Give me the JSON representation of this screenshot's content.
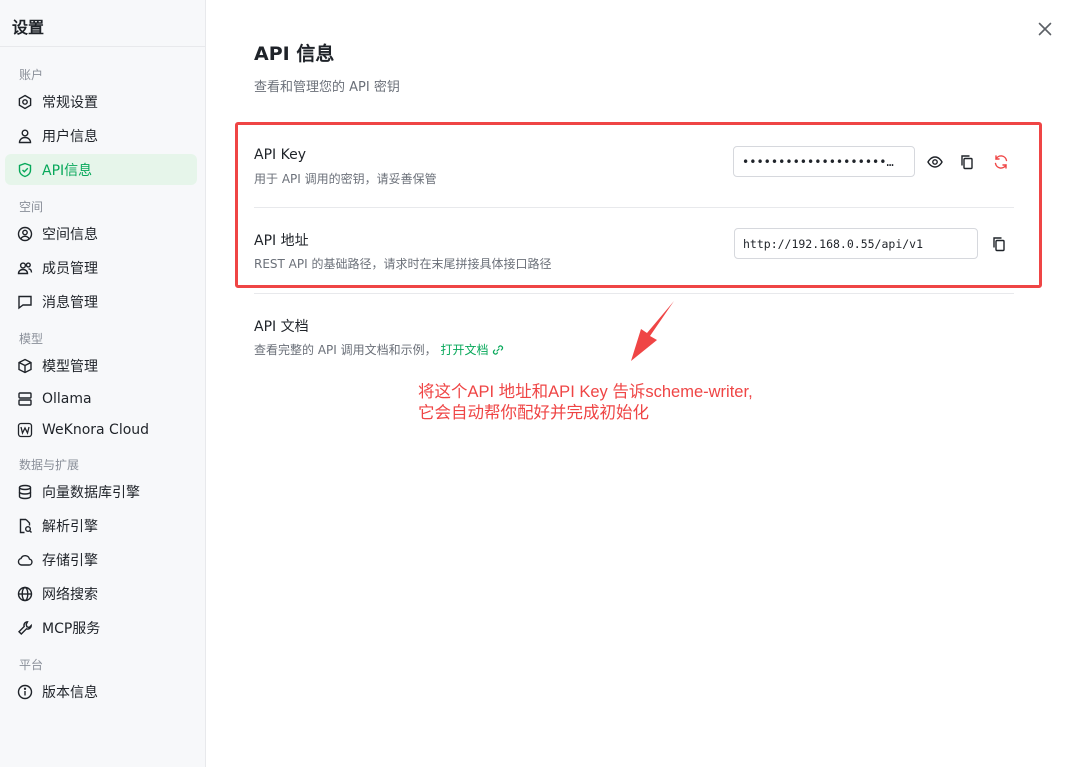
{
  "sidebar": {
    "title": "设置",
    "groups": [
      {
        "label": "账户",
        "items": [
          {
            "label": "常规设置",
            "icon": "settings-hexagon-icon"
          },
          {
            "label": "用户信息",
            "icon": "user-icon"
          },
          {
            "label": "API信息",
            "icon": "shield-check-icon",
            "active": true
          }
        ]
      },
      {
        "label": "空间",
        "items": [
          {
            "label": "空间信息",
            "icon": "user-circle-icon"
          },
          {
            "label": "成员管理",
            "icon": "users-icon"
          },
          {
            "label": "消息管理",
            "icon": "message-square-icon"
          }
        ]
      },
      {
        "label": "模型",
        "items": [
          {
            "label": "模型管理",
            "icon": "cube-icon"
          },
          {
            "label": "Ollama",
            "icon": "server-icon"
          },
          {
            "label": "WeKnora Cloud",
            "icon": "weknora-logo-icon"
          }
        ]
      },
      {
        "label": "数据与扩展",
        "items": [
          {
            "label": "向量数据库引擎",
            "icon": "database-icon"
          },
          {
            "label": "解析引擎",
            "icon": "file-search-icon"
          },
          {
            "label": "存储引擎",
            "icon": "cloud-icon"
          },
          {
            "label": "网络搜索",
            "icon": "globe-icon"
          },
          {
            "label": "MCP服务",
            "icon": "wrench-icon"
          }
        ]
      },
      {
        "label": "平台",
        "items": [
          {
            "label": "版本信息",
            "icon": "info-circle-icon"
          }
        ]
      }
    ]
  },
  "main": {
    "title": "API 信息",
    "subtitle": "查看和管理您的 API 密钥",
    "api_key": {
      "title": "API Key",
      "desc": "用于 API 调用的密钥，请妥善保管",
      "value": "••••••••••••••••••••…"
    },
    "api_url": {
      "title": "API 地址",
      "desc": "REST API 的基础路径，请求时在末尾拼接具体接口路径",
      "value": "http://192.168.0.55/api/v1"
    },
    "api_docs": {
      "title": "API 文档",
      "desc": "查看完整的 API 调用文档和示例，",
      "link_label": "打开文档"
    }
  },
  "annotation": {
    "line1": "将这个API 地址和API Key 告诉scheme-writer,",
    "line2": "它会自动帮你配好并完成初始化"
  },
  "colors": {
    "accent": "#07a85a",
    "active_bg": "#e6f5ea",
    "annotation": "#ef4545"
  }
}
